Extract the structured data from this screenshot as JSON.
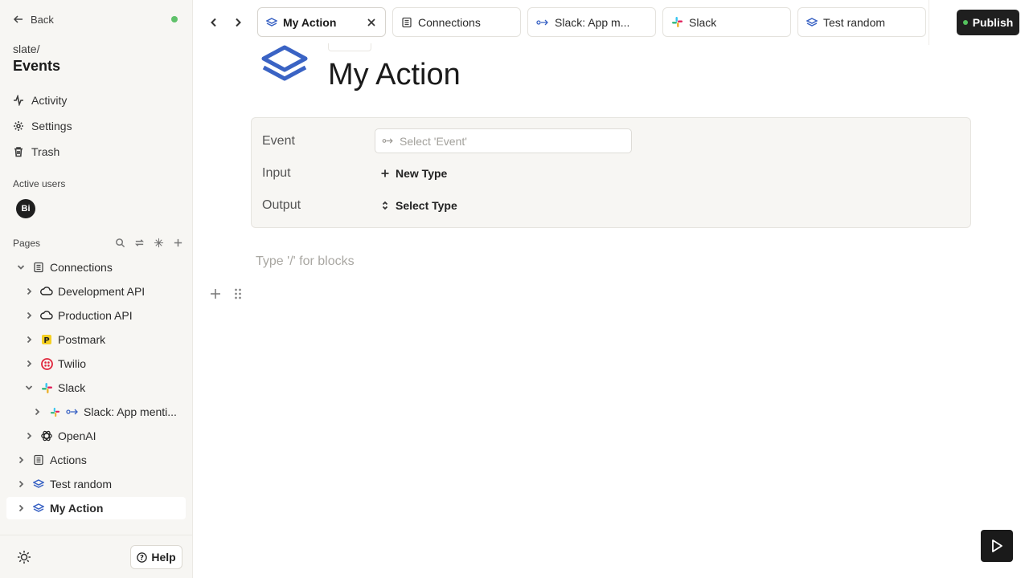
{
  "sidebar": {
    "back_label": "Back",
    "workspace_path": "slate/",
    "workspace_title": "Events",
    "nav": [
      {
        "label": "Activity",
        "icon": "activity-icon"
      },
      {
        "label": "Settings",
        "icon": "gear-icon"
      },
      {
        "label": "Trash",
        "icon": "trash-icon"
      }
    ],
    "active_users_label": "Active users",
    "active_user_initials": "Bi",
    "pages_label": "Pages",
    "tree": [
      {
        "label": "Connections",
        "icon": "document-icon",
        "expanded": true
      },
      {
        "label": "Development API",
        "icon": "cloud-icon"
      },
      {
        "label": "Production API",
        "icon": "cloud-icon"
      },
      {
        "label": "Postmark",
        "icon": "postmark-icon"
      },
      {
        "label": "Twilio",
        "icon": "twilio-icon"
      },
      {
        "label": "Slack",
        "icon": "slack-icon",
        "expanded": true
      },
      {
        "label": "Slack: App menti...",
        "icon": "event-icon"
      },
      {
        "label": "OpenAI",
        "icon": "openai-icon"
      },
      {
        "label": "Actions",
        "icon": "document-icon"
      },
      {
        "label": "Test random",
        "icon": "layers-icon"
      },
      {
        "label": "My Action",
        "icon": "layers-icon",
        "selected": true
      }
    ],
    "help_label": "Help"
  },
  "tabs": [
    {
      "label": "My Action",
      "icon": "layers-icon",
      "active": true
    },
    {
      "label": "Connections",
      "icon": "document-icon"
    },
    {
      "label": "Slack: App m...",
      "icon": "event-icon"
    },
    {
      "label": "Slack",
      "icon": "slack-icon"
    },
    {
      "label": "Test random",
      "icon": "layers-icon"
    }
  ],
  "publish_label": "Publish",
  "page": {
    "title": "My Action",
    "props": {
      "event_label": "Event",
      "event_placeholder": "Select 'Event'",
      "input_label": "Input",
      "input_action": "New Type",
      "output_label": "Output",
      "output_action": "Select Type"
    },
    "block_placeholder": "Type '/' for blocks"
  },
  "colors": {
    "brand_blue": "#3a63c4",
    "publish_bg": "#1f1f1f",
    "online_green": "#5fc16a"
  }
}
